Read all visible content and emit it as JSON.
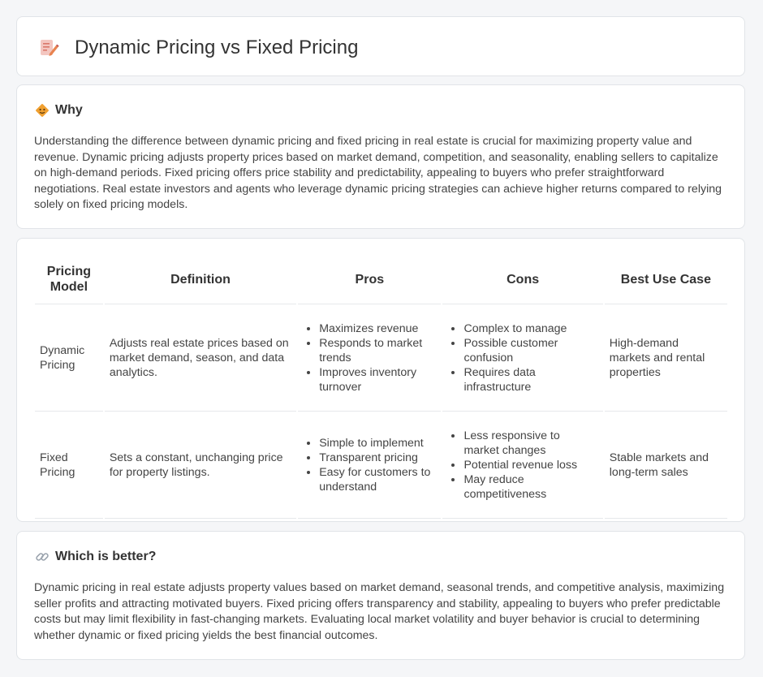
{
  "header": {
    "title": "Dynamic Pricing vs Fixed Pricing",
    "icon": "document-pencil-icon"
  },
  "why": {
    "heading": "Why",
    "icon": "diamond-warning-icon",
    "text": "Understanding the difference between dynamic pricing and fixed pricing in real estate is crucial for maximizing property value and revenue. Dynamic pricing adjusts property prices based on market demand, competition, and seasonality, enabling sellers to capitalize on high-demand periods. Fixed pricing offers price stability and predictability, appealing to buyers who prefer straightforward negotiations. Real estate investors and agents who leverage dynamic pricing strategies can achieve higher returns compared to relying solely on fixed pricing models."
  },
  "table": {
    "columns": [
      "Pricing Model",
      "Definition",
      "Pros",
      "Cons",
      "Best Use Case"
    ],
    "rows": [
      {
        "model": "Dynamic Pricing",
        "definition": "Adjusts real estate prices based on market demand, season, and data analytics.",
        "pros": [
          "Maximizes revenue",
          "Responds to market trends",
          "Improves inventory turnover"
        ],
        "cons": [
          "Complex to manage",
          "Possible customer confusion",
          "Requires data infrastructure"
        ],
        "best_use": "High-demand markets and rental properties"
      },
      {
        "model": "Fixed Pricing",
        "definition": "Sets a constant, unchanging price for property listings.",
        "pros": [
          "Simple to implement",
          "Transparent pricing",
          "Easy for customers to understand"
        ],
        "cons": [
          "Less responsive to market changes",
          "Potential revenue loss",
          "May reduce competitiveness"
        ],
        "best_use": "Stable markets and long-term sales"
      }
    ]
  },
  "better": {
    "heading": "Which is better?",
    "icon": "link-icon",
    "text": "Dynamic pricing in real estate adjusts property values based on market demand, seasonal trends, and competitive analysis, maximizing seller profits and attracting motivated buyers. Fixed pricing offers transparency and stability, appealing to buyers who prefer predictable costs but may limit flexibility in fast-changing markets. Evaluating local market volatility and buyer behavior is crucial to determining whether dynamic or fixed pricing yields the best financial outcomes."
  },
  "colors": {
    "background": "#f5f6f8",
    "card": "#ffffff",
    "accent_orange": "#f0a030",
    "icon_pink": "#e87a6a"
  }
}
